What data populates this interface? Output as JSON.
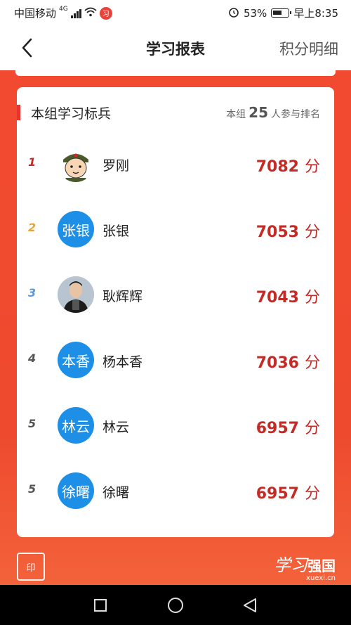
{
  "status_bar": {
    "carrier": "中国移动",
    "network": "4G",
    "battery": "53%",
    "time": "早上8:35",
    "notification_badge": "习"
  },
  "header": {
    "title": "学习报表",
    "right_link": "积分明细"
  },
  "card": {
    "title": "本组学习标兵",
    "group_prefix": "本组",
    "group_count": "25",
    "group_suffix": "人参与排名",
    "score_unit": "分",
    "rows": [
      {
        "rank": "1",
        "name": "罗刚",
        "score": "7082",
        "avatar_text": "",
        "avatar_type": "soldier",
        "rank_color": "#c52a25"
      },
      {
        "rank": "2",
        "name": "张银",
        "score": "7053",
        "avatar_text": "张银",
        "avatar_type": "text",
        "rank_color": "#e8a33c"
      },
      {
        "rank": "3",
        "name": "耿辉辉",
        "score": "7043",
        "avatar_text": "",
        "avatar_type": "photo",
        "rank_color": "#5f9ad6"
      },
      {
        "rank": "4",
        "name": "杨本香",
        "score": "7036",
        "avatar_text": "本香",
        "avatar_type": "text",
        "rank_color": "#555555"
      },
      {
        "rank": "5",
        "name": "林云",
        "score": "6957",
        "avatar_text": "林云",
        "avatar_type": "text",
        "rank_color": "#555555"
      },
      {
        "rank": "5",
        "name": "徐曙",
        "score": "6957",
        "avatar_text": "徐曙",
        "avatar_type": "text",
        "rank_color": "#555555"
      }
    ]
  },
  "footer": {
    "brand_script": "学习",
    "brand_name": "强国",
    "brand_url": "xuexi.cn"
  },
  "colors": {
    "accent_red": "#e8322a",
    "score_red": "#c52a25",
    "avatar_blue": "#1e8fe6"
  }
}
